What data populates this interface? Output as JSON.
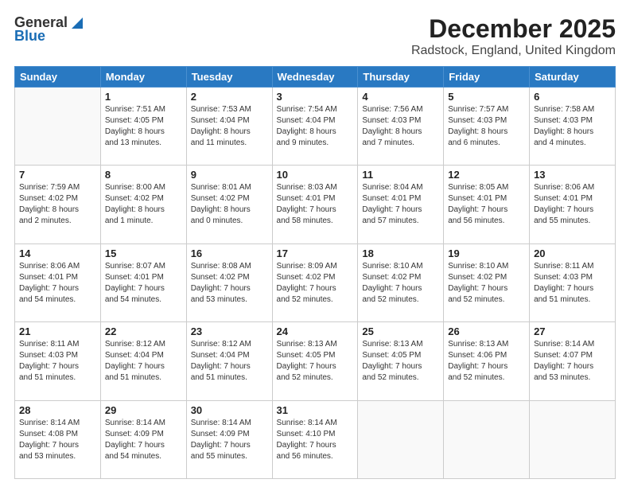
{
  "header": {
    "logo_general": "General",
    "logo_blue": "Blue",
    "main_title": "December 2025",
    "subtitle": "Radstock, England, United Kingdom"
  },
  "calendar": {
    "days_of_week": [
      "Sunday",
      "Monday",
      "Tuesday",
      "Wednesday",
      "Thursday",
      "Friday",
      "Saturday"
    ],
    "weeks": [
      [
        {
          "day": "",
          "info": ""
        },
        {
          "day": "1",
          "info": "Sunrise: 7:51 AM\nSunset: 4:05 PM\nDaylight: 8 hours\nand 13 minutes."
        },
        {
          "day": "2",
          "info": "Sunrise: 7:53 AM\nSunset: 4:04 PM\nDaylight: 8 hours\nand 11 minutes."
        },
        {
          "day": "3",
          "info": "Sunrise: 7:54 AM\nSunset: 4:04 PM\nDaylight: 8 hours\nand 9 minutes."
        },
        {
          "day": "4",
          "info": "Sunrise: 7:56 AM\nSunset: 4:03 PM\nDaylight: 8 hours\nand 7 minutes."
        },
        {
          "day": "5",
          "info": "Sunrise: 7:57 AM\nSunset: 4:03 PM\nDaylight: 8 hours\nand 6 minutes."
        },
        {
          "day": "6",
          "info": "Sunrise: 7:58 AM\nSunset: 4:03 PM\nDaylight: 8 hours\nand 4 minutes."
        }
      ],
      [
        {
          "day": "7",
          "info": "Sunrise: 7:59 AM\nSunset: 4:02 PM\nDaylight: 8 hours\nand 2 minutes."
        },
        {
          "day": "8",
          "info": "Sunrise: 8:00 AM\nSunset: 4:02 PM\nDaylight: 8 hours\nand 1 minute."
        },
        {
          "day": "9",
          "info": "Sunrise: 8:01 AM\nSunset: 4:02 PM\nDaylight: 8 hours\nand 0 minutes."
        },
        {
          "day": "10",
          "info": "Sunrise: 8:03 AM\nSunset: 4:01 PM\nDaylight: 7 hours\nand 58 minutes."
        },
        {
          "day": "11",
          "info": "Sunrise: 8:04 AM\nSunset: 4:01 PM\nDaylight: 7 hours\nand 57 minutes."
        },
        {
          "day": "12",
          "info": "Sunrise: 8:05 AM\nSunset: 4:01 PM\nDaylight: 7 hours\nand 56 minutes."
        },
        {
          "day": "13",
          "info": "Sunrise: 8:06 AM\nSunset: 4:01 PM\nDaylight: 7 hours\nand 55 minutes."
        }
      ],
      [
        {
          "day": "14",
          "info": "Sunrise: 8:06 AM\nSunset: 4:01 PM\nDaylight: 7 hours\nand 54 minutes."
        },
        {
          "day": "15",
          "info": "Sunrise: 8:07 AM\nSunset: 4:01 PM\nDaylight: 7 hours\nand 54 minutes."
        },
        {
          "day": "16",
          "info": "Sunrise: 8:08 AM\nSunset: 4:02 PM\nDaylight: 7 hours\nand 53 minutes."
        },
        {
          "day": "17",
          "info": "Sunrise: 8:09 AM\nSunset: 4:02 PM\nDaylight: 7 hours\nand 52 minutes."
        },
        {
          "day": "18",
          "info": "Sunrise: 8:10 AM\nSunset: 4:02 PM\nDaylight: 7 hours\nand 52 minutes."
        },
        {
          "day": "19",
          "info": "Sunrise: 8:10 AM\nSunset: 4:02 PM\nDaylight: 7 hours\nand 52 minutes."
        },
        {
          "day": "20",
          "info": "Sunrise: 8:11 AM\nSunset: 4:03 PM\nDaylight: 7 hours\nand 51 minutes."
        }
      ],
      [
        {
          "day": "21",
          "info": "Sunrise: 8:11 AM\nSunset: 4:03 PM\nDaylight: 7 hours\nand 51 minutes."
        },
        {
          "day": "22",
          "info": "Sunrise: 8:12 AM\nSunset: 4:04 PM\nDaylight: 7 hours\nand 51 minutes."
        },
        {
          "day": "23",
          "info": "Sunrise: 8:12 AM\nSunset: 4:04 PM\nDaylight: 7 hours\nand 51 minutes."
        },
        {
          "day": "24",
          "info": "Sunrise: 8:13 AM\nSunset: 4:05 PM\nDaylight: 7 hours\nand 52 minutes."
        },
        {
          "day": "25",
          "info": "Sunrise: 8:13 AM\nSunset: 4:05 PM\nDaylight: 7 hours\nand 52 minutes."
        },
        {
          "day": "26",
          "info": "Sunrise: 8:13 AM\nSunset: 4:06 PM\nDaylight: 7 hours\nand 52 minutes."
        },
        {
          "day": "27",
          "info": "Sunrise: 8:14 AM\nSunset: 4:07 PM\nDaylight: 7 hours\nand 53 minutes."
        }
      ],
      [
        {
          "day": "28",
          "info": "Sunrise: 8:14 AM\nSunset: 4:08 PM\nDaylight: 7 hours\nand 53 minutes."
        },
        {
          "day": "29",
          "info": "Sunrise: 8:14 AM\nSunset: 4:09 PM\nDaylight: 7 hours\nand 54 minutes."
        },
        {
          "day": "30",
          "info": "Sunrise: 8:14 AM\nSunset: 4:09 PM\nDaylight: 7 hours\nand 55 minutes."
        },
        {
          "day": "31",
          "info": "Sunrise: 8:14 AM\nSunset: 4:10 PM\nDaylight: 7 hours\nand 56 minutes."
        },
        {
          "day": "",
          "info": ""
        },
        {
          "day": "",
          "info": ""
        },
        {
          "day": "",
          "info": ""
        }
      ]
    ]
  }
}
